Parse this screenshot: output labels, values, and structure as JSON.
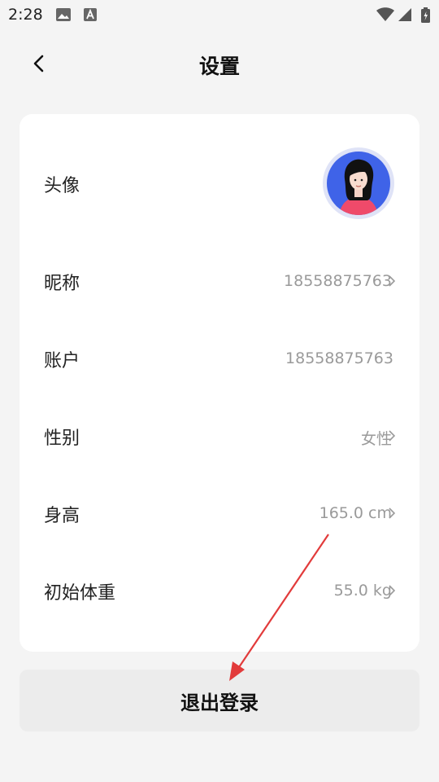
{
  "status_bar": {
    "time": "2:28"
  },
  "header": {
    "title": "设置"
  },
  "settings": {
    "avatar_label": "头像",
    "nickname": {
      "label": "昵称",
      "value": "18558875763"
    },
    "account": {
      "label": "账户",
      "value": "18558875763"
    },
    "gender": {
      "label": "性别",
      "value": "女性"
    },
    "height": {
      "label": "身高",
      "value": "165.0 cm"
    },
    "initial_weight": {
      "label": "初始体重",
      "value": "55.0 kg"
    }
  },
  "logout": {
    "label": "退出登录"
  },
  "colors": {
    "avatar_ring": "#3f63e8",
    "avatar_shirt": "#ef4a6a",
    "annotation_arrow": "#e23b3b"
  },
  "icons": [
    "image-icon",
    "font-icon",
    "wifi-icon",
    "signal-icon",
    "battery-icon",
    "back-arrow-icon",
    "chevron-right-icon"
  ]
}
